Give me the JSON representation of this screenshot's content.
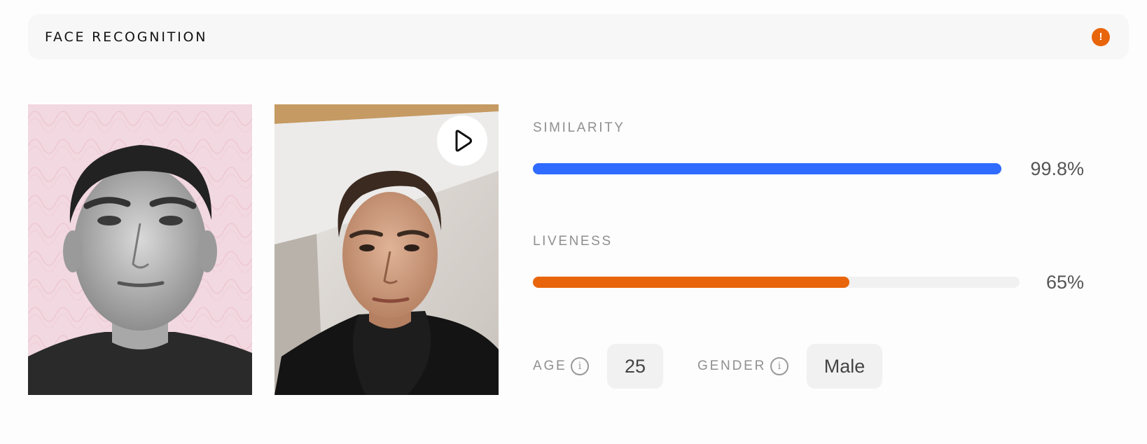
{
  "header": {
    "title": "FACE RECOGNITION",
    "alert_icon": "exclamation-circle-icon",
    "alert_color": "#e8650b",
    "alert_glyph": "!"
  },
  "photos": {
    "id_photo": {
      "name": "id-document-photo"
    },
    "selfie": {
      "name": "selfie-video-frame",
      "play_icon": "play-icon"
    }
  },
  "metrics": {
    "similarity": {
      "label": "SIMILARITY",
      "value": "99.8%",
      "fraction": 0.998,
      "color": "#2f6bff"
    },
    "liveness": {
      "label": "LIVENESS",
      "value": "65%",
      "fraction": 0.65,
      "color": "#e8650b"
    }
  },
  "attributes": {
    "age": {
      "label": "AGE",
      "value": "25",
      "info_icon": "info-icon"
    },
    "gender": {
      "label": "GENDER",
      "value": "Male",
      "info_icon": "info-icon"
    }
  }
}
